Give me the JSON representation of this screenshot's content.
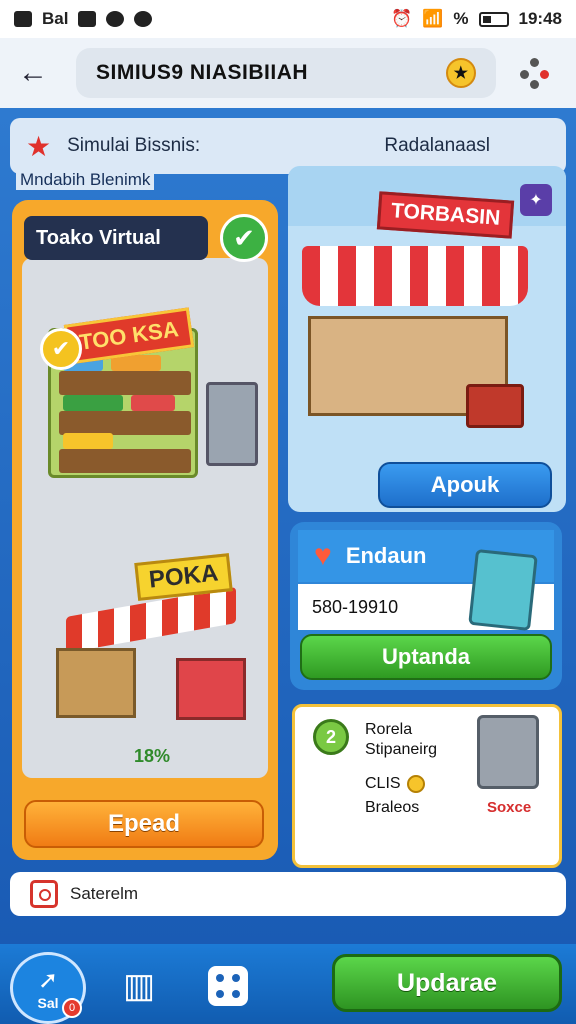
{
  "status_bar": {
    "left_label": "Bal",
    "battery_label": "%",
    "time": "19:48"
  },
  "app_bar": {
    "title": "SIMIUS9 NIASIBIIAH",
    "back_icon": "arrow-left-icon",
    "badge_icon": "star-badge-icon",
    "menu_icon": "dots-menu-icon"
  },
  "header": {
    "title": "Simulai Bissnis:",
    "right_label": "Radalanaasl",
    "subhead": "Mndabih Blenimk"
  },
  "left_card": {
    "store_name": "Toako Virtual",
    "shelf_sign": "TOO KSA",
    "stall_sign": "POKA",
    "progress_percent": "18%",
    "button_label": "Epead",
    "colors": {
      "frame": "#f7a82b",
      "button": "#f07c14"
    }
  },
  "right_card": {
    "shop_sign": "TORBASIN",
    "button_label": "Apouk"
  },
  "earn_card": {
    "title": "Endaun",
    "value": "580-19910",
    "button_label": "Uptanda"
  },
  "info_card": {
    "number": "2",
    "line1": "Rorela",
    "line2": "Stipaneirg",
    "line3": "CLIS",
    "line4": "Braleos",
    "red_label": "Soxce"
  },
  "search": {
    "value": "Saterelm"
  },
  "bottom_nav": {
    "home_label": "Sal",
    "badge": "0",
    "upgrade_label": "Updarae"
  }
}
